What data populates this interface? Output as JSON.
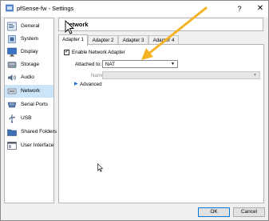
{
  "window": {
    "title": "pfSense-fw - Settings"
  },
  "titlebar": {
    "help": "?",
    "close": "✕"
  },
  "sidebar": {
    "items": [
      {
        "label": "General",
        "icon": "general-icon"
      },
      {
        "label": "System",
        "icon": "system-icon"
      },
      {
        "label": "Display",
        "icon": "display-icon"
      },
      {
        "label": "Storage",
        "icon": "storage-icon"
      },
      {
        "label": "Audio",
        "icon": "audio-icon"
      },
      {
        "label": "Network",
        "icon": "network-icon",
        "selected": true
      },
      {
        "label": "Serial Ports",
        "icon": "serial-ports-icon"
      },
      {
        "label": "USB",
        "icon": "usb-icon"
      },
      {
        "label": "Shared Folders",
        "icon": "shared-folders-icon"
      },
      {
        "label": "User Interface",
        "icon": "user-interface-icon"
      }
    ]
  },
  "main": {
    "section_title": "Network",
    "tabs": [
      {
        "label": "Adapter 1",
        "active": true
      },
      {
        "label": "Adapter 2"
      },
      {
        "label": "Adapter 3"
      },
      {
        "label": "Adapter 4"
      }
    ],
    "enable_adapter": {
      "label": "Enable Network Adapter",
      "checked": true
    },
    "attached_to": {
      "label": "Attached to:",
      "value": "NAT"
    },
    "name": {
      "label": "Name:",
      "value": ""
    },
    "advanced": {
      "label": "Advanced"
    }
  },
  "footer": {
    "ok_label": "OK",
    "cancel_label": "Cancel"
  },
  "colors": {
    "selection": "#cce4f7",
    "annotation_arrow": "#f5b324",
    "advanced_triangle": "#1a6fd6"
  }
}
